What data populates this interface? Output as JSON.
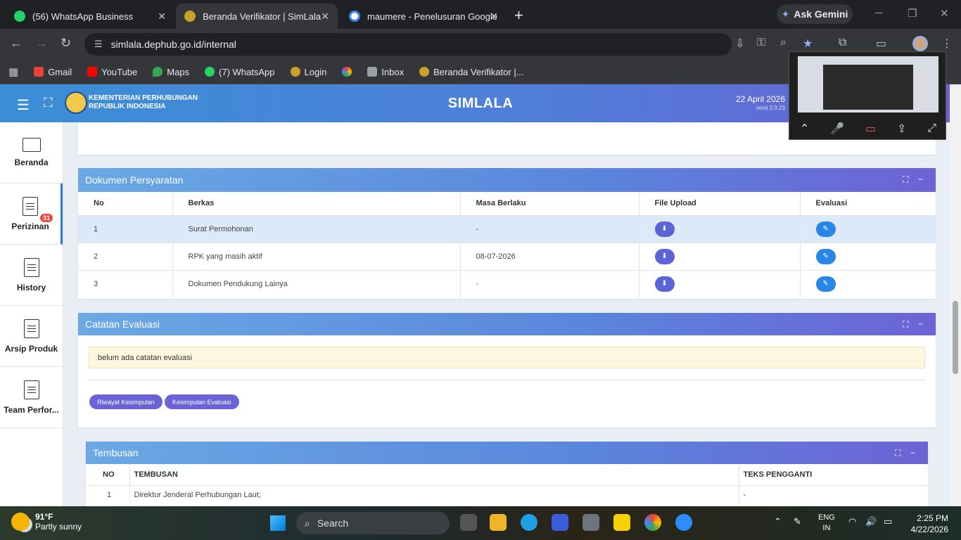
{
  "browser": {
    "tabs": [
      {
        "title": "(56) WhatsApp Business",
        "active": false,
        "icon_color": "#25d366"
      },
      {
        "title": "Beranda Verifikator | SimLala",
        "active": true,
        "icon_color": "#c9a227"
      },
      {
        "title": "maumere - Penelusuran Google",
        "active": false,
        "icon_color": "#ffffff"
      }
    ],
    "gemini_label": "Ask Gemini",
    "url": "simlala.dephub.go.id/internal",
    "bookmarks": [
      {
        "label": "Gmail",
        "icon_color": "#ea4335"
      },
      {
        "label": "YouTube",
        "icon_color": "#ff0000"
      },
      {
        "label": "Maps",
        "icon_color": "#34a853"
      },
      {
        "label": "(7) WhatsApp",
        "icon_color": "#25d366"
      },
      {
        "label": "Login",
        "icon_color": "#c9a227"
      },
      {
        "label": "",
        "icon_color": "#fbbc04"
      },
      {
        "label": "Inbox",
        "icon_color": "#9aa0a6"
      },
      {
        "label": "Beranda Verifikator |...",
        "icon_color": "#c9a227"
      }
    ]
  },
  "app": {
    "org_line1": "KEMENTERIAN PERHUBUNGAN",
    "org_line2": "REPUBLIK INDONESIA",
    "title": "SIMLALA",
    "date": "22 April 2026",
    "version": "versi 2.0.23"
  },
  "sidebar": {
    "items": [
      {
        "label": "Beranda",
        "icon": "monitor-icon"
      },
      {
        "label": "Perizinan",
        "icon": "document-icon",
        "badge": "31",
        "active": true
      },
      {
        "label": "History",
        "icon": "document-icon"
      },
      {
        "label": "Arsip Produk",
        "icon": "document-icon"
      },
      {
        "label": "Team Perfor...",
        "icon": "document-icon"
      }
    ]
  },
  "dokumen": {
    "title": "Dokumen Persyaratan",
    "columns": [
      "No",
      "Berkas",
      "Masa Berlaku",
      "File Upload",
      "Evaluasi"
    ],
    "rows": [
      {
        "no": "1",
        "berkas": "Surat Permohonan",
        "masa": "-"
      },
      {
        "no": "2",
        "berkas": "RPK yang masih aktif",
        "masa": "08-07-2026"
      },
      {
        "no": "3",
        "berkas": "Dokumen Pendukung Lainya",
        "masa": "-"
      }
    ]
  },
  "catatan": {
    "title": "Catatan Evaluasi",
    "note": "belum ada catatan evaluasi",
    "btn_riwayat": "Riwayat Kesimpulan",
    "btn_kesimpulan": "Kesimpulan Evaluasi"
  },
  "tembusan": {
    "title": "Tembusan",
    "columns": [
      "NO",
      "TEMBUSAN",
      "TEKS PENGGANTI"
    ],
    "rows": [
      {
        "no": "1",
        "tembusan": "Direktur Jenderal Perhubungan Laut;",
        "teks": "-"
      }
    ]
  },
  "taskbar": {
    "temp": "91°F",
    "weather": "Partly sunny",
    "search_placeholder": "Search",
    "lang1": "ENG",
    "lang2": "IN",
    "time": "2:25 PM",
    "date": "4/22/2026"
  }
}
